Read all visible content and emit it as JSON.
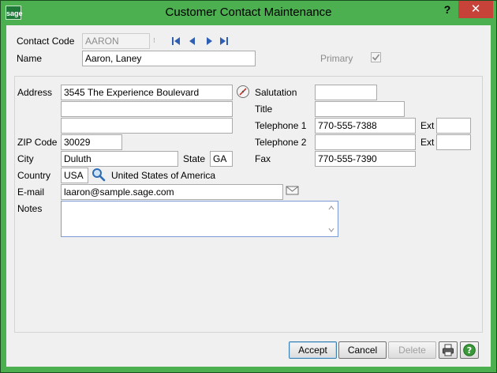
{
  "window": {
    "title": "Customer Contact Maintenance",
    "logo": "sage",
    "help_label": "?",
    "close_label": "✕"
  },
  "header": {
    "contact_code_label": "Contact Code",
    "contact_code_value": "AARON",
    "name_label": "Name",
    "name_value": "Aaron, Laney",
    "primary_label": "Primary",
    "primary_checked": true
  },
  "form": {
    "address_label": "Address",
    "address_line1": "3545 The Experience Boulevard",
    "address_line2": "",
    "address_line3": "",
    "zip_label": "ZIP Code",
    "zip_value": "30029",
    "city_label": "City",
    "city_value": "Duluth",
    "state_label": "State",
    "state_value": "GA",
    "country_label": "Country",
    "country_value": "USA",
    "country_name": "United States of America",
    "email_label": "E-mail",
    "email_value": "laaron@sample.sage.com",
    "notes_label": "Notes",
    "notes_value": "",
    "salutation_label": "Salutation",
    "salutation_value": "",
    "title_label": "Title",
    "title_value": "",
    "telephone1_label": "Telephone 1",
    "telephone1_value": "770-555-7388",
    "ext1_label": "Ext",
    "ext1_value": "",
    "telephone2_label": "Telephone 2",
    "telephone2_value": "",
    "ext2_label": "Ext",
    "ext2_value": "",
    "fax_label": "Fax",
    "fax_value": "770-555-7390"
  },
  "footer": {
    "accept_label": "Accept",
    "cancel_label": "Cancel",
    "delete_label": "Delete"
  },
  "colors": {
    "title_bar": "#4caf50",
    "close_button": "#c7433a",
    "nav_arrows": "#2f5fb3"
  }
}
